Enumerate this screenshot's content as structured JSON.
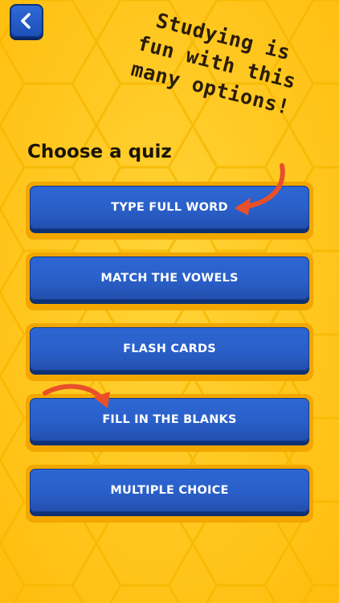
{
  "nav": {
    "back_icon": "chevron-left-icon"
  },
  "promo": {
    "lines": [
      "Studying is",
      "fun with this",
      "many options!"
    ]
  },
  "section": {
    "title": "Choose a quiz"
  },
  "quizzes": [
    {
      "label": "TYPE FULL WORD"
    },
    {
      "label": "MATCH THE VOWELS"
    },
    {
      "label": "FLASH CARDS"
    },
    {
      "label": "FILL IN THE BLANKS"
    },
    {
      "label": "MULTIPLE CHOICE"
    }
  ],
  "colors": {
    "background": "#ffc71a",
    "button": "#2a5fc8",
    "button_shadow": "#0f3174",
    "arrow": "#e8502a",
    "slot": "#f2a700"
  }
}
